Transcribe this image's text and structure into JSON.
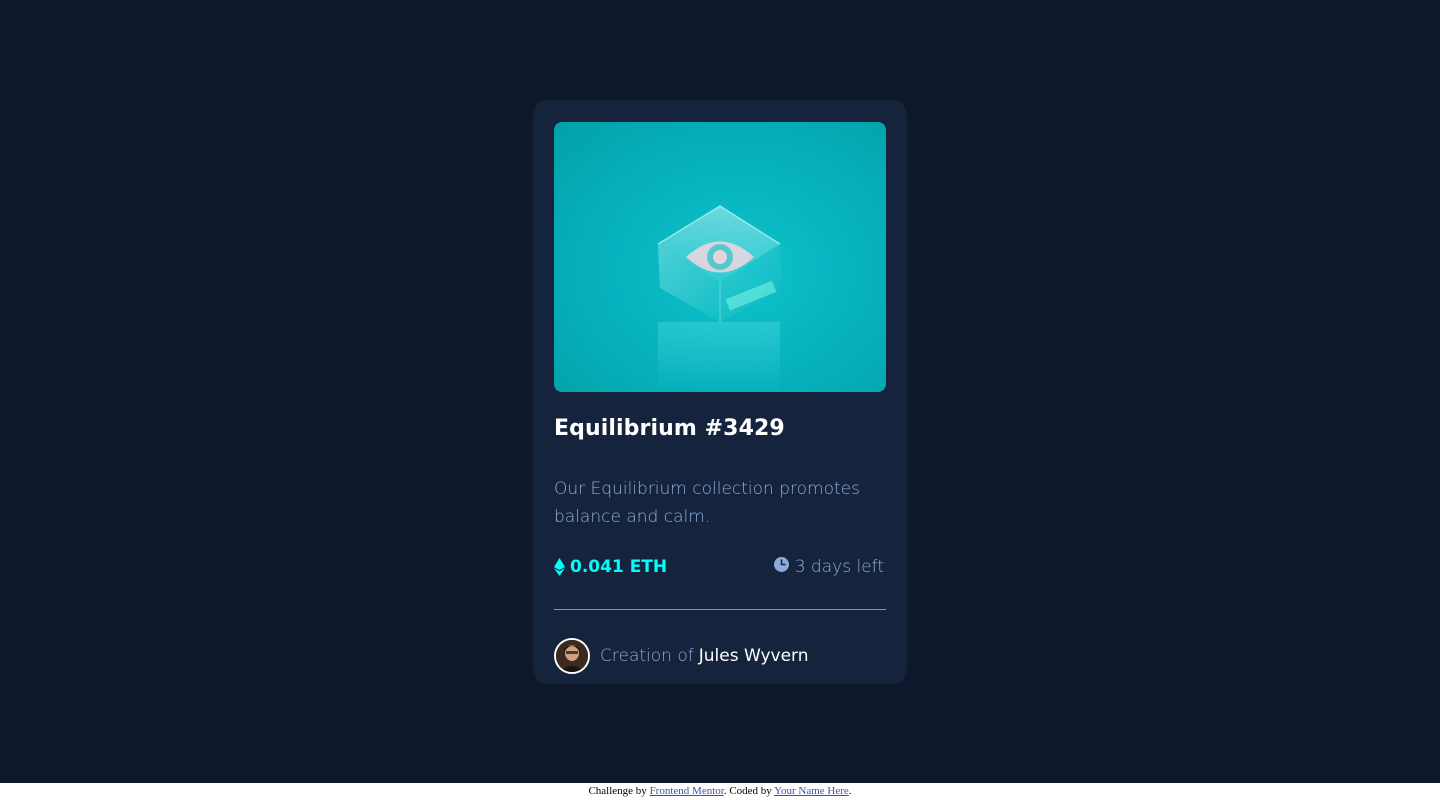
{
  "colors": {
    "page_background": "#0f182b",
    "card_background": "#15243c",
    "accent_cyan": "#00fff8",
    "soft_blue": "#8bacd9",
    "white": "#ffffff"
  },
  "card": {
    "image_icon": "equilibrium-cube-eye-image",
    "title": "Equilibrium #3429",
    "description": "Our Equilibrium collection promotes balance and calm.",
    "price": {
      "icon": "ethereum-icon",
      "value": "0.041 ETH"
    },
    "time": {
      "icon": "clock-icon",
      "value": "3 days left"
    },
    "creator": {
      "avatar_icon": "avatar-image",
      "prefix": "Creation of",
      "name": "Jules Wyvern"
    }
  },
  "attribution": {
    "prefix": "Challenge by",
    "challenge_link": "Frontend Mentor",
    "middle": ". Coded by",
    "author_link": "Your Name Here",
    "suffix": "."
  }
}
